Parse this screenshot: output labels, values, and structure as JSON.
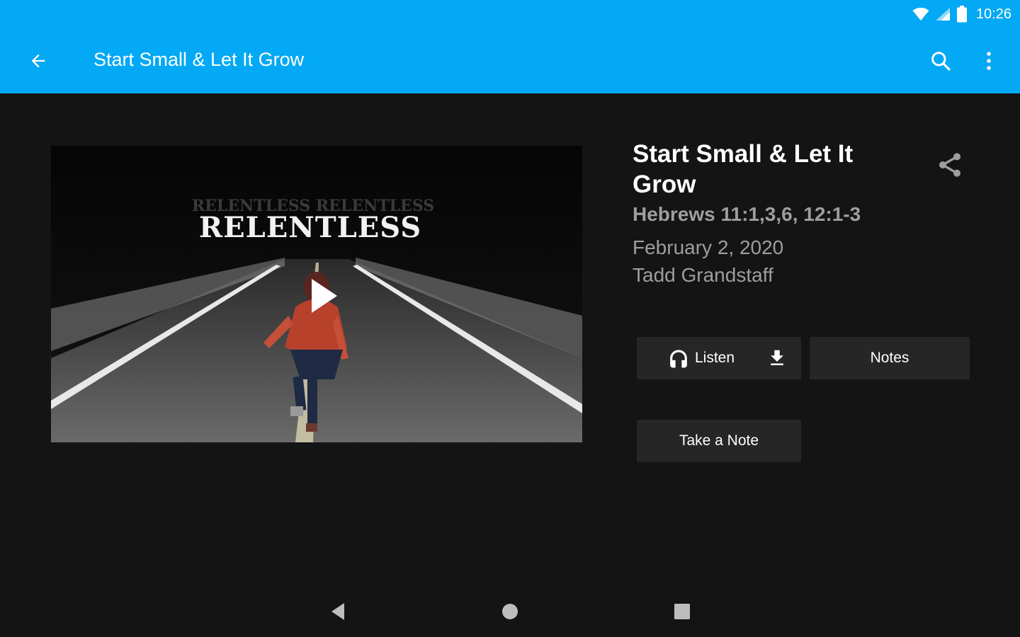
{
  "status_bar": {
    "time": "10:26",
    "icons": [
      "wifi-icon",
      "signal-icon",
      "battery-icon"
    ]
  },
  "toolbar": {
    "title": "Start Small & Let It Grow",
    "icons": [
      "arrow-back-icon",
      "search-icon",
      "more-vert-icon"
    ]
  },
  "video": {
    "title_text": "RELENTLESS",
    "icon": "play-icon"
  },
  "sermon": {
    "title": "Start Small & Let It Grow",
    "scripture": "Hebrews 11:1,3,6, 12:1-3",
    "date": "February 2, 2020",
    "speaker": "Tadd Grandstaff",
    "share_icon": "share-icon"
  },
  "actions": {
    "listen_label": "Listen",
    "notes_label": "Notes",
    "take_note_label": "Take a Note",
    "icons": [
      "headphones-icon",
      "download-icon"
    ]
  },
  "colors": {
    "app_bar": "#03a9f4",
    "background": "#141414",
    "button": "#262626",
    "secondary_text": "#9e9e9e"
  }
}
